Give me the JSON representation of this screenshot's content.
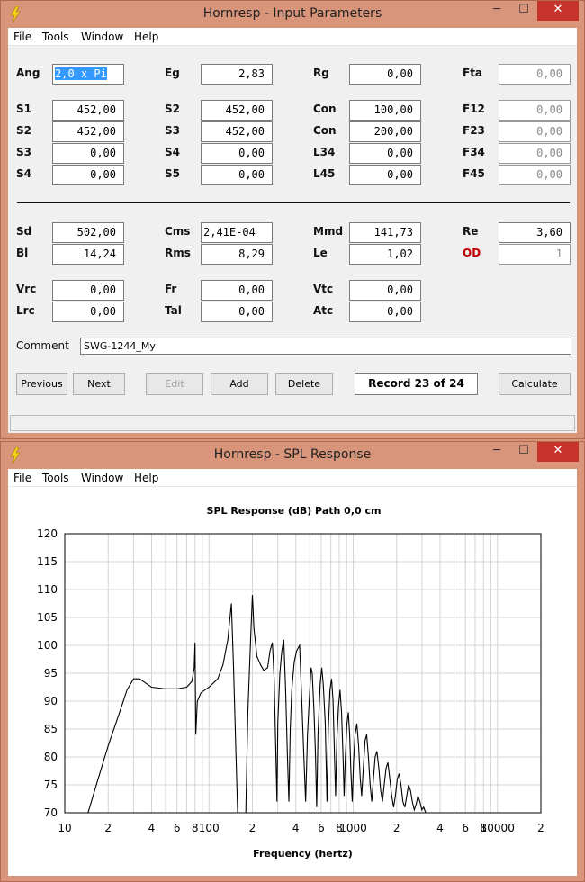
{
  "input_window": {
    "title": "Hornresp - Input Parameters",
    "controls": {
      "minimize": "─",
      "maximize": "☐",
      "close": "✕"
    },
    "menu": [
      "File",
      "Tools",
      "Window",
      "Help"
    ],
    "fields": [
      {
        "label": "Ang",
        "value": "2,0 x Pi",
        "state": "selected"
      },
      {
        "label": "Eg",
        "value": "2,83"
      },
      {
        "label": "Rg",
        "value": "0,00"
      },
      {
        "label": "Fta",
        "value": "0,00",
        "state": "disabled"
      },
      {
        "label": "S1",
        "value": "452,00"
      },
      {
        "label": "S2",
        "value": "452,00"
      },
      {
        "label": "Con",
        "value": "100,00"
      },
      {
        "label": "F12",
        "value": "0,00",
        "state": "disabled"
      },
      {
        "label": "S2",
        "value": "452,00"
      },
      {
        "label": "S3",
        "value": "452,00"
      },
      {
        "label": "Con",
        "value": "200,00"
      },
      {
        "label": "F23",
        "value": "0,00",
        "state": "disabled"
      },
      {
        "label": "S3",
        "value": "0,00"
      },
      {
        "label": "S4",
        "value": "0,00"
      },
      {
        "label": "L34",
        "value": "0,00"
      },
      {
        "label": "F34",
        "value": "0,00",
        "state": "disabled"
      },
      {
        "label": "S4",
        "value": "0,00"
      },
      {
        "label": "S5",
        "value": "0,00"
      },
      {
        "label": "L45",
        "value": "0,00"
      },
      {
        "label": "F45",
        "value": "0,00",
        "state": "disabled"
      },
      {
        "label": "Sd",
        "value": "502,00"
      },
      {
        "label": "Cms",
        "value": "2,41E-04"
      },
      {
        "label": "Mmd",
        "value": "141,73"
      },
      {
        "label": "Re",
        "value": "3,60"
      },
      {
        "label": "Bl",
        "value": "14,24"
      },
      {
        "label": "Rms",
        "value": "8,29"
      },
      {
        "label": "Le",
        "value": "1,02"
      },
      {
        "label": "OD",
        "value": "1",
        "state": "disabled",
        "label_color": "#c00000"
      },
      {
        "label": "Vrc",
        "value": "0,00"
      },
      {
        "label": "Fr",
        "value": "0,00"
      },
      {
        "label": "Vtc",
        "value": "0,00"
      },
      {
        "label": "Lrc",
        "value": "0,00"
      },
      {
        "label": "Tal",
        "value": "0,00"
      },
      {
        "label": "Atc",
        "value": "0,00"
      }
    ],
    "comment_label": "Comment",
    "comment_value": "SWG-1244_My",
    "buttons": {
      "previous": "Previous",
      "next": "Next",
      "edit": "Edit",
      "add": "Add",
      "delete": "Delete",
      "calculate": "Calculate"
    },
    "record": "Record 23 of 24"
  },
  "spl_window": {
    "title": "Hornresp - SPL Response",
    "controls": {
      "minimize": "─",
      "maximize": "☐",
      "close": "✕"
    },
    "menu": [
      "File",
      "Tools",
      "Window",
      "Help"
    ]
  },
  "chart_data": {
    "type": "line",
    "title": "SPL Response (dB)   Path 0,0 cm",
    "xlabel": "Frequency (hertz)",
    "ylabel": "",
    "x_scale": "log",
    "xlim": [
      10,
      20000
    ],
    "ylim": [
      70,
      120
    ],
    "grid": true,
    "y_ticks": [
      "70",
      "75",
      "80",
      "85",
      "90",
      "95",
      "100",
      "105",
      "110",
      "115",
      "120"
    ],
    "x_ticks": [
      {
        "f": 10,
        "label": "10"
      },
      {
        "f": 20,
        "label": "2"
      },
      {
        "f": 40,
        "label": "4"
      },
      {
        "f": 60,
        "label": "6"
      },
      {
        "f": 80,
        "label": "8"
      },
      {
        "f": 100,
        "label": "100"
      },
      {
        "f": 200,
        "label": "2"
      },
      {
        "f": 400,
        "label": "4"
      },
      {
        "f": 600,
        "label": "6"
      },
      {
        "f": 800,
        "label": "8"
      },
      {
        "f": 1000,
        "label": "1000"
      },
      {
        "f": 2000,
        "label": "2"
      },
      {
        "f": 4000,
        "label": "4"
      },
      {
        "f": 6000,
        "label": "6"
      },
      {
        "f": 8000,
        "label": "8"
      },
      {
        "f": 10000,
        "label": "10000"
      },
      {
        "f": 20000,
        "label": "2"
      }
    ],
    "series": [
      {
        "color": "#000000",
        "points": [
          [
            14.5,
            70
          ],
          [
            17,
            76
          ],
          [
            20,
            82
          ],
          [
            24,
            88
          ],
          [
            27,
            92
          ],
          [
            30,
            94
          ],
          [
            33,
            94
          ],
          [
            40,
            92.5
          ],
          [
            50,
            92.2
          ],
          [
            60,
            92.2
          ],
          [
            70,
            92.5
          ],
          [
            76,
            93.5
          ],
          [
            79,
            96
          ],
          [
            80,
            100.5
          ],
          [
            81,
            84
          ],
          [
            83,
            90
          ],
          [
            88,
            91.5
          ],
          [
            100,
            92.5
          ],
          [
            115,
            94
          ],
          [
            125,
            96.5
          ],
          [
            135,
            101
          ],
          [
            143,
            107.5
          ],
          [
            148,
            96
          ],
          [
            154,
            80
          ],
          [
            158,
            70
          ],
          [
            180,
            70
          ],
          [
            186,
            88
          ],
          [
            195,
            102
          ],
          [
            200,
            109
          ],
          [
            205,
            103
          ],
          [
            215,
            98
          ],
          [
            228,
            96.5
          ],
          [
            240,
            95.5
          ],
          [
            255,
            96
          ],
          [
            265,
            99
          ],
          [
            275,
            100.5
          ],
          [
            283,
            94
          ],
          [
            290,
            82
          ],
          [
            296,
            72
          ],
          [
            300,
            86
          ],
          [
            310,
            95
          ],
          [
            320,
            99
          ],
          [
            330,
            101
          ],
          [
            340,
            92
          ],
          [
            350,
            80
          ],
          [
            358,
            72
          ],
          [
            366,
            85
          ],
          [
            375,
            92
          ],
          [
            390,
            97
          ],
          [
            405,
            99
          ],
          [
            425,
            100
          ],
          [
            440,
            90
          ],
          [
            455,
            80
          ],
          [
            468,
            72
          ],
          [
            482,
            84
          ],
          [
            495,
            90
          ],
          [
            510,
            96
          ],
          [
            520,
            95
          ],
          [
            535,
            88
          ],
          [
            548,
            80
          ],
          [
            558,
            71
          ],
          [
            570,
            84
          ],
          [
            590,
            93
          ],
          [
            605,
            96
          ],
          [
            620,
            93
          ],
          [
            640,
            86
          ],
          [
            658,
            72
          ],
          [
            672,
            85
          ],
          [
            690,
            92
          ],
          [
            708,
            94
          ],
          [
            725,
            90
          ],
          [
            742,
            80
          ],
          [
            755,
            73
          ],
          [
            770,
            83
          ],
          [
            790,
            89
          ],
          [
            810,
            92
          ],
          [
            830,
            88
          ],
          [
            850,
            80
          ],
          [
            865,
            73
          ],
          [
            882,
            80
          ],
          [
            905,
            86
          ],
          [
            925,
            88
          ],
          [
            945,
            84
          ],
          [
            965,
            77
          ],
          [
            985,
            72
          ],
          [
            1005,
            79
          ],
          [
            1030,
            84
          ],
          [
            1060,
            86
          ],
          [
            1090,
            82
          ],
          [
            1120,
            76
          ],
          [
            1145,
            73
          ],
          [
            1175,
            78
          ],
          [
            1210,
            83
          ],
          [
            1240,
            84
          ],
          [
            1275,
            80
          ],
          [
            1310,
            75
          ],
          [
            1345,
            72
          ],
          [
            1380,
            76
          ],
          [
            1420,
            80
          ],
          [
            1460,
            81
          ],
          [
            1505,
            78
          ],
          [
            1550,
            74
          ],
          [
            1595,
            72
          ],
          [
            1640,
            75
          ],
          [
            1690,
            78
          ],
          [
            1740,
            79
          ],
          [
            1795,
            76
          ],
          [
            1850,
            73
          ],
          [
            1905,
            71
          ],
          [
            1960,
            73
          ],
          [
            2020,
            76
          ],
          [
            2080,
            77
          ],
          [
            2145,
            75
          ],
          [
            2210,
            72
          ],
          [
            2280,
            71
          ],
          [
            2350,
            73
          ],
          [
            2420,
            75
          ],
          [
            2495,
            74
          ],
          [
            2570,
            72
          ],
          [
            2650,
            70.5
          ],
          [
            2730,
            71.5
          ],
          [
            2810,
            73
          ],
          [
            2900,
            72
          ],
          [
            2990,
            70.5
          ],
          [
            3080,
            71
          ],
          [
            3180,
            70
          ]
        ]
      }
    ]
  }
}
